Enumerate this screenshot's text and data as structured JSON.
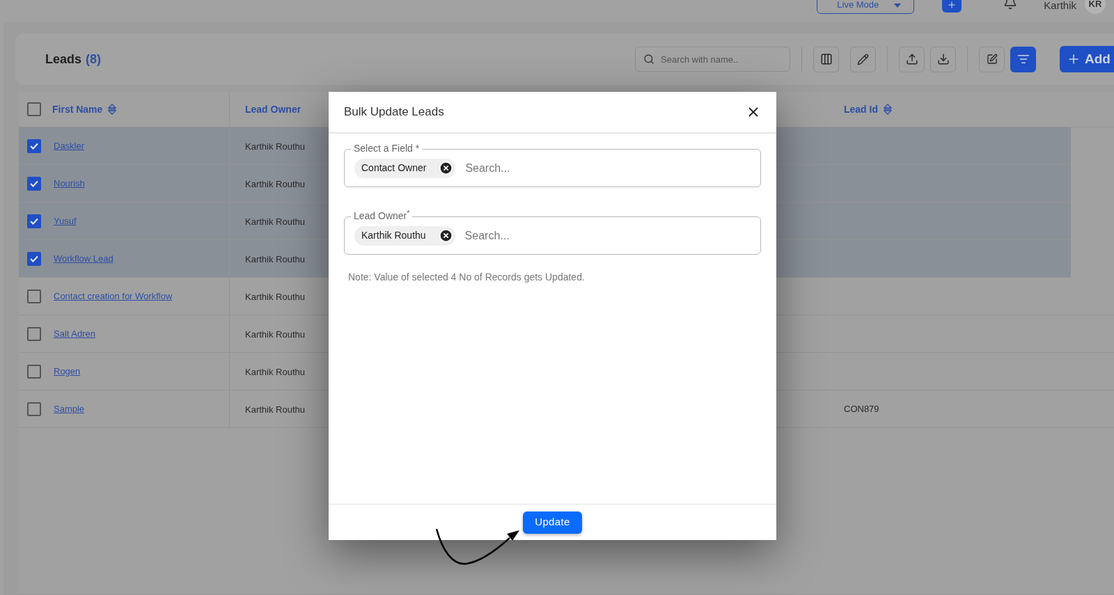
{
  "topbar": {
    "mode_dropdown": "Live Mode",
    "user_name": "Karthik",
    "avatar_initials": "KR"
  },
  "header": {
    "title": "Leads",
    "count": "(8)",
    "search": {
      "placeholder": "Search with name.."
    },
    "add_button": "Add"
  },
  "table": {
    "header_checked": false,
    "columns": [
      {
        "label": "First Name",
        "sortable": true
      },
      {
        "label": "Lead Owner",
        "sortable": false
      },
      {
        "label": "Lead Id",
        "sortable": true
      }
    ],
    "rows": [
      {
        "first_name": "Daskler",
        "lead_owner": "Karthik Routhu",
        "checked": true
      },
      {
        "first_name": "Nourish",
        "lead_owner": "Karthik Routhu",
        "checked": true
      },
      {
        "first_name": "Yusuf",
        "lead_owner": "Karthik Routhu",
        "checked": true
      },
      {
        "first_name": "Workflow Lead",
        "lead_owner": "Karthik Routhu",
        "checked": true
      },
      {
        "first_name": "Contact creation for Workflow",
        "lead_owner": "Karthik Routhu",
        "checked": false
      },
      {
        "first_name": "Salt Adren",
        "lead_owner": "Karthik Routhu",
        "checked": false
      },
      {
        "first_name": "Rogen",
        "lead_owner": "Karthik Routhu",
        "checked": false
      },
      {
        "first_name": "Sample",
        "lead_owner": "Karthik Routhu",
        "lead_id": "CON879",
        "checked": false
      }
    ]
  },
  "modal": {
    "title": "Bulk Update Leads",
    "fields": [
      {
        "label": "Select a Field *",
        "chip": "Contact Owner",
        "placeholder": "Search..."
      },
      {
        "label": "Lead Owner$^{*}$",
        "chip": "Karthik Routhu",
        "placeholder": "Search..."
      }
    ],
    "note": "Note: Value of selected 4 No of Records gets Updated.",
    "button": "Update"
  }
}
